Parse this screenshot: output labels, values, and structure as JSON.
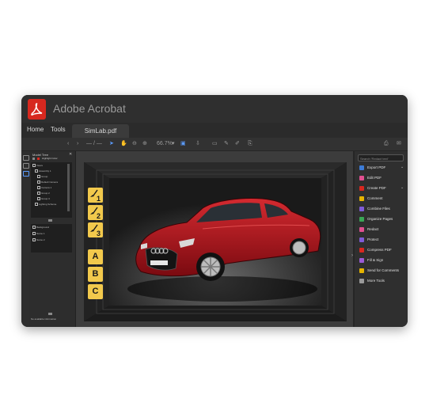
{
  "app": {
    "title": "Adobe Acrobat",
    "brand_color": "#d7281f"
  },
  "menu": {
    "items": [
      "Home",
      "Tools"
    ],
    "document_tab": "SimLab.pdf"
  },
  "toolbar": {
    "zoom": "66.7%"
  },
  "model_tree": {
    "title": "Model Tree",
    "items": [
      "Highlight Color",
      "Views",
      "Assembly 1",
      "Group",
      "Default Camera",
      "Camera 1",
      "Group 2",
      "Group 3",
      "Lighting Scheme"
    ],
    "lower_items": [
      "Background",
      "Name 1",
      "Name 2"
    ],
    "status": "No available information"
  },
  "scene": {
    "buttons": [
      {
        "label": "1",
        "icon": "brush-icon"
      },
      {
        "label": "2",
        "icon": "brush-icon"
      },
      {
        "label": "3",
        "icon": "brush-icon"
      },
      {
        "label": "A"
      },
      {
        "label": "B"
      },
      {
        "label": "C"
      }
    ],
    "car_color": "#b3121b"
  },
  "tools_pane": {
    "search_placeholder": "Search 'Redact text'",
    "tools": [
      {
        "label": "Export PDF",
        "color": "#3c7bd6",
        "expandable": true
      },
      {
        "label": "Edit PDF",
        "color": "#e04f8f"
      },
      {
        "label": "Create PDF",
        "color": "#d7281f",
        "expandable": true
      },
      {
        "label": "Comment",
        "color": "#e6b400"
      },
      {
        "label": "Combine Files",
        "color": "#7f5bd6"
      },
      {
        "label": "Organize Pages",
        "color": "#3aa655"
      },
      {
        "label": "Redact",
        "color": "#e04f8f"
      },
      {
        "label": "Protect",
        "color": "#7f5bd6"
      },
      {
        "label": "Compress PDF",
        "color": "#d7281f"
      },
      {
        "label": "Fill & Sign",
        "color": "#9a5bd6"
      },
      {
        "label": "Send for Comments",
        "color": "#e6b400"
      },
      {
        "label": "More Tools",
        "color": "#9a9a9a"
      }
    ]
  }
}
